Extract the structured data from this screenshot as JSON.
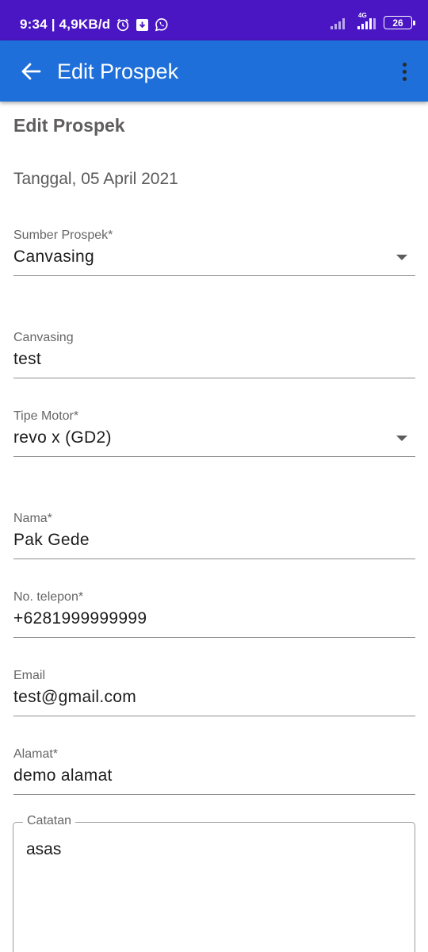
{
  "status_bar": {
    "time_speed": "9:34 | 4,9KB/d",
    "network_label": "4G",
    "battery": "26",
    "icons": [
      "alarm-icon",
      "download-app-icon",
      "whatsapp-icon",
      "signal-icon",
      "signal-4g-icon",
      "battery-icon"
    ]
  },
  "app_bar": {
    "title": "Edit Prospek",
    "back_icon": "arrow-left-icon",
    "menu_icon": "more-vert-icon",
    "background": "#1e6fd9"
  },
  "form": {
    "title": "Edit Prospek",
    "date": "Tanggal, 05 April 2021",
    "sumber_prospek": {
      "label": "Sumber Prospek*",
      "value": "Canvasing"
    },
    "canvasing": {
      "label": "Canvasing",
      "value": "test"
    },
    "tipe_motor": {
      "label": "Tipe Motor*",
      "value": "revo x (GD2)"
    },
    "nama": {
      "label": "Nama*",
      "value": "Pak Gede"
    },
    "telepon": {
      "label": "No. telepon*",
      "value": "+6281999999999"
    },
    "email": {
      "label": "Email",
      "value": "test@gmail.com"
    },
    "alamat": {
      "label": "Alamat*",
      "value": "demo alamat"
    },
    "catatan": {
      "label": "Catatan",
      "value": "asas"
    }
  },
  "colors": {
    "status_bar": "#4a16c4",
    "app_bar": "#1e6fd9",
    "section_title": "#5f5d5d"
  }
}
